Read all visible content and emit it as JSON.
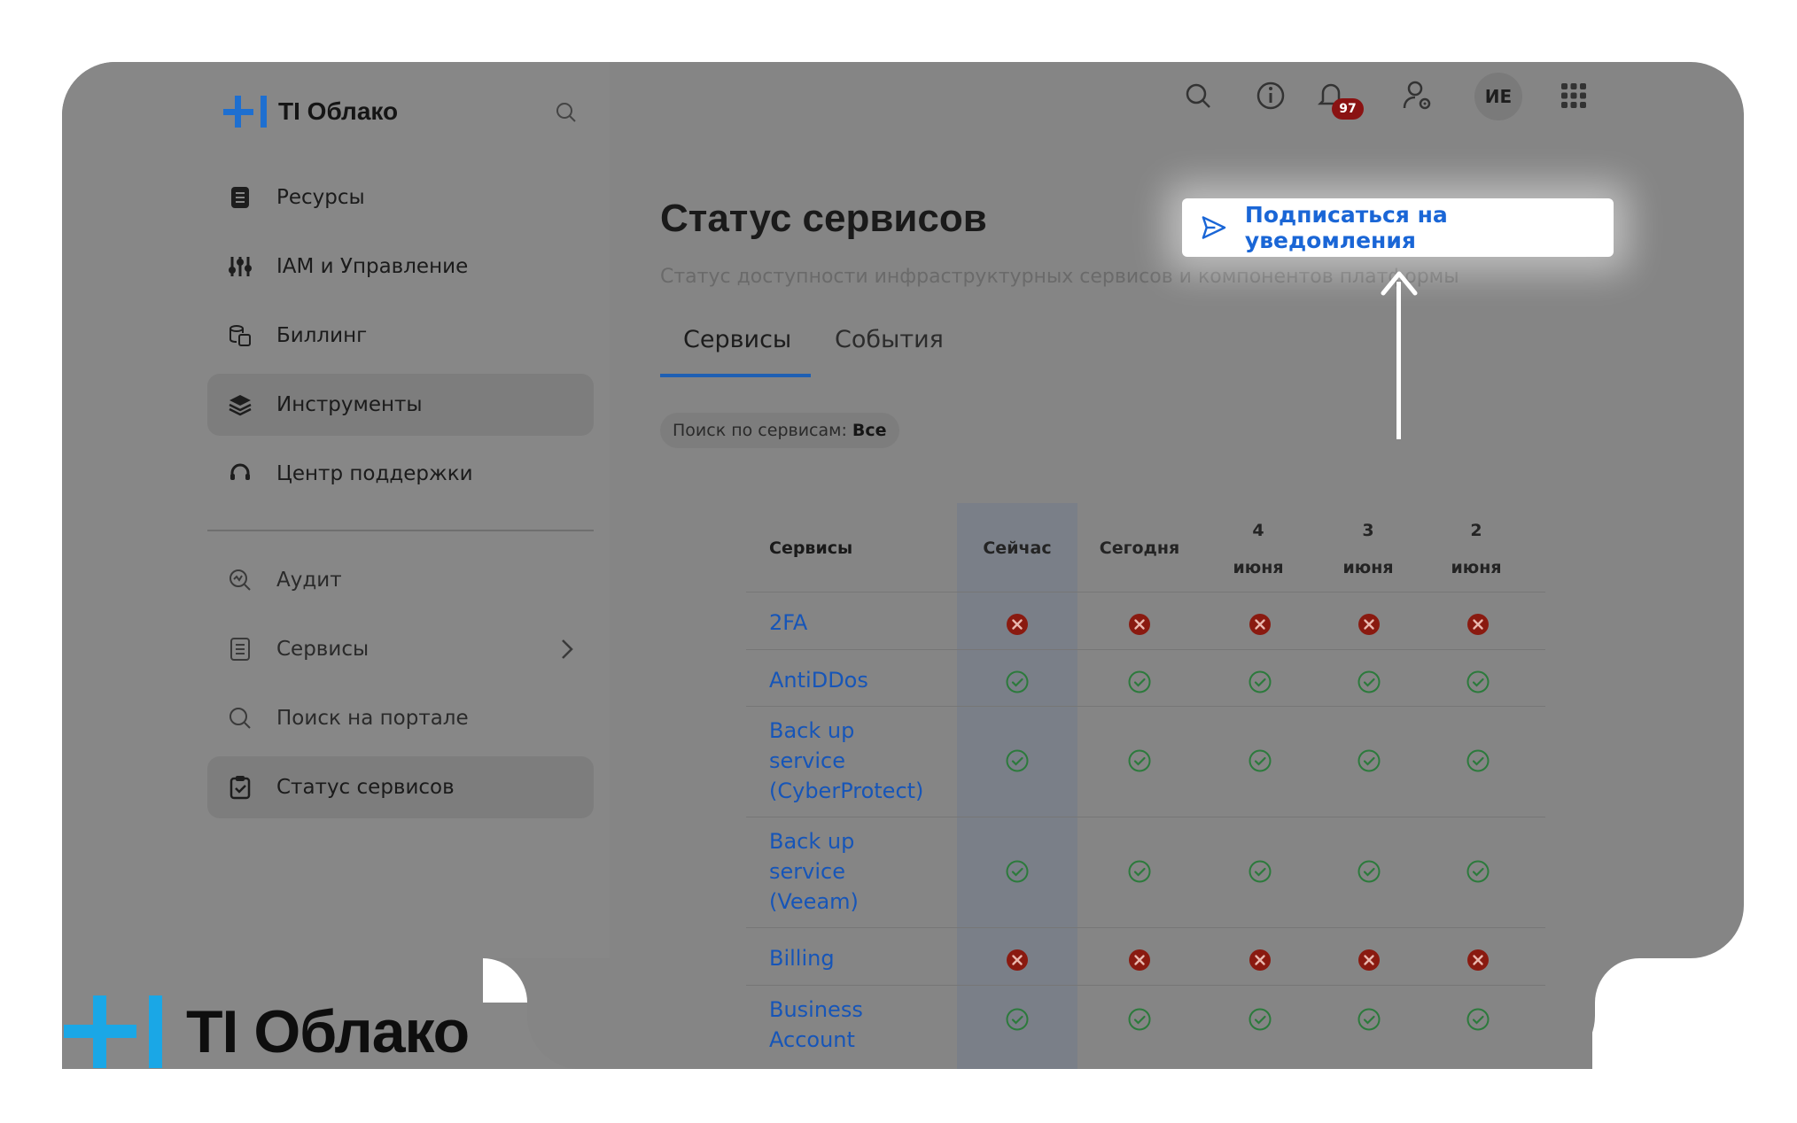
{
  "brand": {
    "name": "TI Облако",
    "bottom_logo": "TI Облако"
  },
  "sidebar": {
    "items": [
      {
        "label": "Ресурсы",
        "icon": "resources-icon"
      },
      {
        "label": "IAM и Управление",
        "icon": "iam-icon"
      },
      {
        "label": "Биллинг",
        "icon": "billing-icon"
      },
      {
        "label": "Инструменты",
        "icon": "tools-icon"
      },
      {
        "label": "Центр поддержки",
        "icon": "support-icon"
      }
    ],
    "secondary": [
      {
        "label": "Аудит",
        "icon": "audit-icon"
      },
      {
        "label": "Сервисы",
        "icon": "services-icon"
      },
      {
        "label": "Поиск на портале",
        "icon": "search-icon"
      },
      {
        "label": "Статус сервисов",
        "icon": "status-icon"
      }
    ]
  },
  "topbar": {
    "notifications_count": "97",
    "avatar_initials": "ИЕ"
  },
  "page": {
    "title": "Статус сервисов",
    "subtitle": "Статус доступности инфраструктурных сервисов и компонентов платформы",
    "subscribe_label": "Подписаться на уведомления",
    "tabs": [
      "Сервисы",
      "События"
    ],
    "filter_label": "Поиск по сервисам:",
    "filter_value": "Все"
  },
  "table": {
    "headers": {
      "services": "Сервисы",
      "now": "Сейчас",
      "today": "Сегодня",
      "d4_num": "4",
      "d4_month": "июня",
      "d3_num": "3",
      "d3_month": "июня",
      "d2_num": "2",
      "d2_month": "июня"
    },
    "rows": [
      {
        "name_lines": [
          "2FA"
        ],
        "statuses": [
          "error",
          "error",
          "error",
          "error",
          "error"
        ]
      },
      {
        "name_lines": [
          "AntiDDos"
        ],
        "statuses": [
          "ok",
          "ok",
          "ok",
          "ok",
          "ok"
        ]
      },
      {
        "name_lines": [
          "Back up",
          "service",
          "(CyberProtect)"
        ],
        "statuses": [
          "ok",
          "ok",
          "ok",
          "ok",
          "ok"
        ]
      },
      {
        "name_lines": [
          "Back up",
          "service",
          "(Veeam)"
        ],
        "statuses": [
          "ok",
          "ok",
          "ok",
          "ok",
          "ok"
        ]
      },
      {
        "name_lines": [
          "Billing"
        ],
        "statuses": [
          "error",
          "error",
          "error",
          "error",
          "error"
        ]
      },
      {
        "name_lines": [
          "Business",
          "Account"
        ],
        "statuses": [
          "ok",
          "ok",
          "ok",
          "ok",
          "ok"
        ]
      }
    ]
  },
  "colors": {
    "accent": "#1a66d6",
    "error": "#8a1a10",
    "ok": "#2c7a3c",
    "overlay": "#858585"
  }
}
